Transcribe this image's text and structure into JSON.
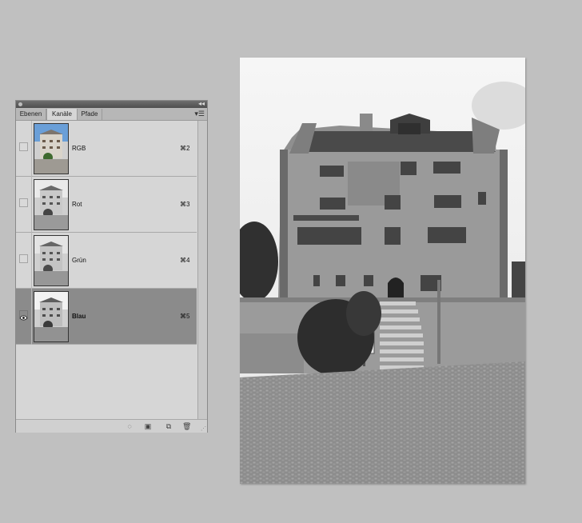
{
  "panel": {
    "tabs": [
      {
        "label": "Ebenen",
        "active": false
      },
      {
        "label": "Kanäle",
        "active": true
      },
      {
        "label": "Pfade",
        "active": false
      }
    ],
    "channels": [
      {
        "name": "RGB",
        "shortcut": "⌘2",
        "visible": false,
        "selected": false
      },
      {
        "name": "Rot",
        "shortcut": "⌘3",
        "visible": false,
        "selected": false
      },
      {
        "name": "Grün",
        "shortcut": "⌘4",
        "visible": false,
        "selected": false
      },
      {
        "name": "Blau",
        "shortcut": "⌘5",
        "visible": true,
        "selected": true
      }
    ],
    "bottom_icons": [
      "load-selection-icon",
      "save-selection-icon",
      "new-channel-icon",
      "trash-icon"
    ]
  },
  "document": {
    "mode": "grayscale",
    "subject": "castle-photo"
  },
  "colors": {
    "canvas_bg": "#c0c0c0",
    "panel_bg": "#d6d6d6",
    "selected_row": "#8b8b8b"
  }
}
